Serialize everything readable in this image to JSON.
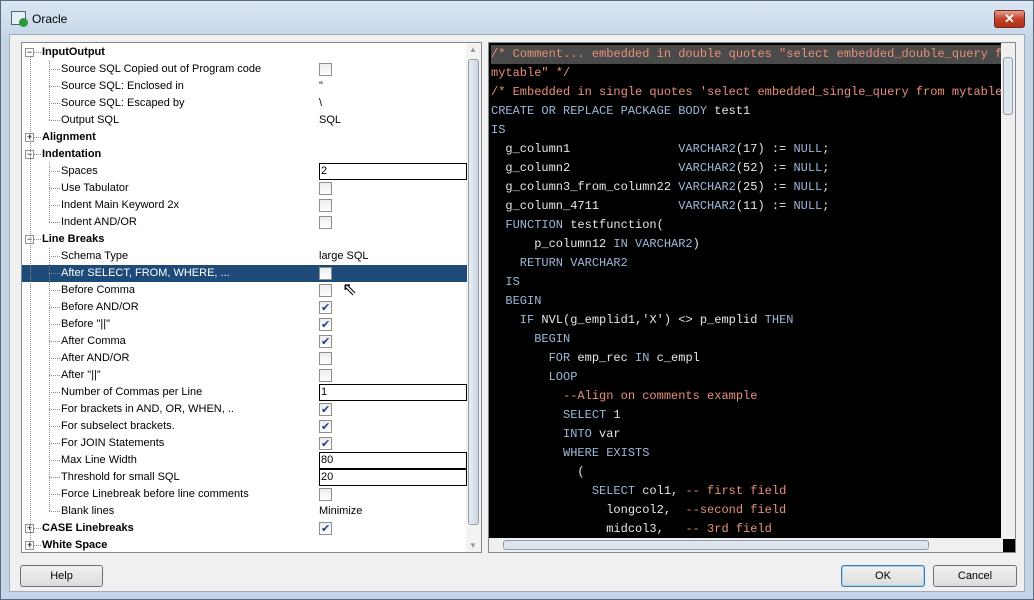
{
  "window": {
    "title": "Oracle"
  },
  "tree": [
    {
      "type": "group",
      "label": "InputOutput",
      "expanded": true
    },
    {
      "label": "Source SQL Copied out of Program code",
      "kind": "check",
      "value": false
    },
    {
      "label": "Source SQL: Enclosed in",
      "kind": "text",
      "value": "\""
    },
    {
      "label": "Source SQL: Escaped by",
      "kind": "text",
      "value": "\\"
    },
    {
      "label": "Output SQL",
      "kind": "text",
      "value": "SQL",
      "last": true
    },
    {
      "type": "group",
      "label": "Alignment",
      "expanded": false
    },
    {
      "type": "group",
      "label": "Indentation",
      "expanded": true
    },
    {
      "label": "Spaces",
      "kind": "input",
      "value": "2"
    },
    {
      "label": "Use Tabulator",
      "kind": "check",
      "value": false
    },
    {
      "label": "Indent Main Keyword 2x",
      "kind": "check",
      "value": false
    },
    {
      "label": "Indent AND/OR",
      "kind": "check",
      "value": false,
      "last": true
    },
    {
      "type": "group",
      "label": "Line Breaks",
      "expanded": true
    },
    {
      "label": "Schema Type",
      "kind": "text",
      "value": "large SQL"
    },
    {
      "label": "After SELECT, FROM, WHERE, ...",
      "kind": "check",
      "value": false,
      "selected": true
    },
    {
      "label": "Before Comma",
      "kind": "check",
      "value": false
    },
    {
      "label": "Before AND/OR",
      "kind": "check",
      "value": true
    },
    {
      "label": "Before \"||\"",
      "kind": "check",
      "value": true
    },
    {
      "label": "After Comma",
      "kind": "check",
      "value": true
    },
    {
      "label": "After AND/OR",
      "kind": "check",
      "value": false
    },
    {
      "label": "After \"||\"",
      "kind": "check",
      "value": false
    },
    {
      "label": "Number of Commas per Line",
      "kind": "input",
      "value": "1"
    },
    {
      "label": "For brackets in AND, OR, WHEN, ..",
      "kind": "check",
      "value": true
    },
    {
      "label": "For subselect brackets.",
      "kind": "check",
      "value": true
    },
    {
      "label": "For JOIN Statements",
      "kind": "check",
      "value": true
    },
    {
      "label": "Max Line Width",
      "kind": "input",
      "value": "80"
    },
    {
      "label": "Threshold for small SQL",
      "kind": "input",
      "value": "20"
    },
    {
      "label": "Force Linebreak before line comments",
      "kind": "check",
      "value": false
    },
    {
      "label": "Blank lines",
      "kind": "text",
      "value": "Minimize",
      "last": true
    },
    {
      "type": "group",
      "label": "CASE Linebreaks",
      "expanded": false,
      "kind": "check",
      "value": true
    },
    {
      "type": "group",
      "label": "White Space",
      "expanded": false
    }
  ],
  "code": [
    [
      [
        "c",
        "/* Comment... embedded in double quotes \"select embedded_double_query from"
      ]
    ],
    [
      [
        "c",
        "mytable\" */"
      ]
    ],
    [
      [
        "c",
        "/* Embedded in single quotes 'select embedded_single_query from mytable'"
      ]
    ],
    [
      [
        "k",
        "CREATE OR REPLACE PACKAGE BODY "
      ],
      [
        "t",
        "test1"
      ]
    ],
    [
      [
        "k",
        "IS"
      ]
    ],
    [
      [
        "t",
        "  g_column1               "
      ],
      [
        "k",
        "VARCHAR2"
      ],
      [
        "t",
        "(17) := "
      ],
      [
        "k",
        "NULL"
      ],
      [
        "t",
        ";"
      ]
    ],
    [
      [
        "t",
        "  g_column2               "
      ],
      [
        "k",
        "VARCHAR2"
      ],
      [
        "t",
        "(52) := "
      ],
      [
        "k",
        "NULL"
      ],
      [
        "t",
        ";"
      ]
    ],
    [
      [
        "t",
        "  g_column3_from_column22 "
      ],
      [
        "k",
        "VARCHAR2"
      ],
      [
        "t",
        "(25) := "
      ],
      [
        "k",
        "NULL"
      ],
      [
        "t",
        ";"
      ]
    ],
    [
      [
        "t",
        "  g_column_4711           "
      ],
      [
        "k",
        "VARCHAR2"
      ],
      [
        "t",
        "(11) := "
      ],
      [
        "k",
        "NULL"
      ],
      [
        "t",
        ";"
      ]
    ],
    [
      [
        "k",
        "  FUNCTION "
      ],
      [
        "t",
        "testfunction("
      ]
    ],
    [
      [
        "t",
        "      p_column12 "
      ],
      [
        "k",
        "IN VARCHAR2"
      ],
      [
        "t",
        ")"
      ]
    ],
    [
      [
        "k",
        "    RETURN VARCHAR2"
      ]
    ],
    [
      [
        "k",
        "  IS"
      ]
    ],
    [
      [
        "k",
        "  BEGIN"
      ]
    ],
    [
      [
        "k",
        "    IF "
      ],
      [
        "t",
        "NVL(g_emplid1,'X') <> p_emplid "
      ],
      [
        "k",
        "THEN"
      ]
    ],
    [
      [
        "k",
        "      BEGIN"
      ]
    ],
    [
      [
        "k",
        "        FOR "
      ],
      [
        "t",
        "emp_rec "
      ],
      [
        "k",
        "IN "
      ],
      [
        "t",
        "c_empl"
      ]
    ],
    [
      [
        "k",
        "        LOOP"
      ]
    ],
    [
      [
        "c",
        "          --Align on comments example"
      ]
    ],
    [
      [
        "k",
        "          SELECT "
      ],
      [
        "t",
        "1"
      ]
    ],
    [
      [
        "k",
        "          INTO "
      ],
      [
        "t",
        "var"
      ]
    ],
    [
      [
        "k",
        "          WHERE EXISTS"
      ]
    ],
    [
      [
        "t",
        "            ("
      ]
    ],
    [
      [
        "k",
        "              SELECT "
      ],
      [
        "t",
        "col1, "
      ],
      [
        "c",
        "-- first field"
      ]
    ],
    [
      [
        "t",
        "                longcol2,  "
      ],
      [
        "c",
        "--second field"
      ]
    ],
    [
      [
        "t",
        "                midcol3,   "
      ],
      [
        "c",
        "-- 3rd field"
      ]
    ]
  ],
  "buttons": {
    "help": "Help",
    "ok": "OK",
    "cancel": "Cancel"
  },
  "colors": {
    "keyword": "#9cb8d6",
    "comment": "#e8907a",
    "text": "#e6e6e6",
    "selection": "#1e4a7a"
  }
}
